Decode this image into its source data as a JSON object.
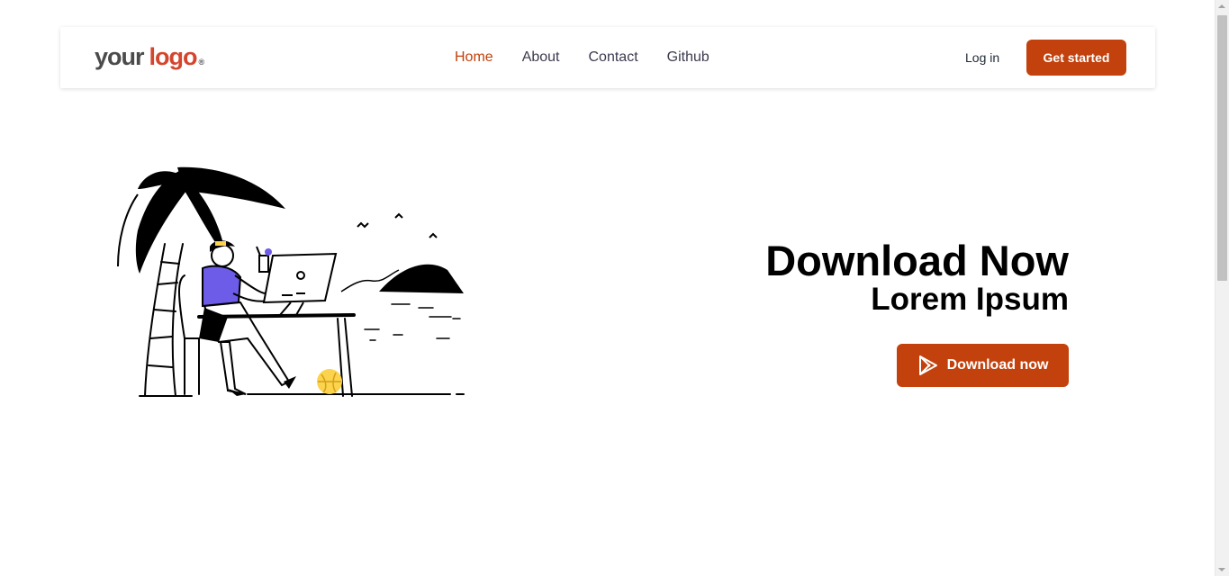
{
  "navbar": {
    "logo": {
      "word1": "your",
      "word2": "logo",
      "mark": "®"
    },
    "links": [
      {
        "label": "Home",
        "active": true
      },
      {
        "label": "About",
        "active": false
      },
      {
        "label": "Contact",
        "active": false
      },
      {
        "label": "Github",
        "active": false
      }
    ],
    "login_label": "Log in",
    "cta_label": "Get started"
  },
  "hero": {
    "title": "Download Now",
    "subtitle": "Lorem Ipsum",
    "download_label": "Download now",
    "download_icon": "play-store-icon",
    "illustration": "person-working-on-laptop-at-beach-illustration"
  },
  "colors": {
    "accent": "#c2410c",
    "logo_primary": "#4b4b4b",
    "logo_accent": "#d4452d",
    "nav_text": "#3b3b4f",
    "shirt": "#6c5ce7",
    "ball": "#fcd34d"
  }
}
